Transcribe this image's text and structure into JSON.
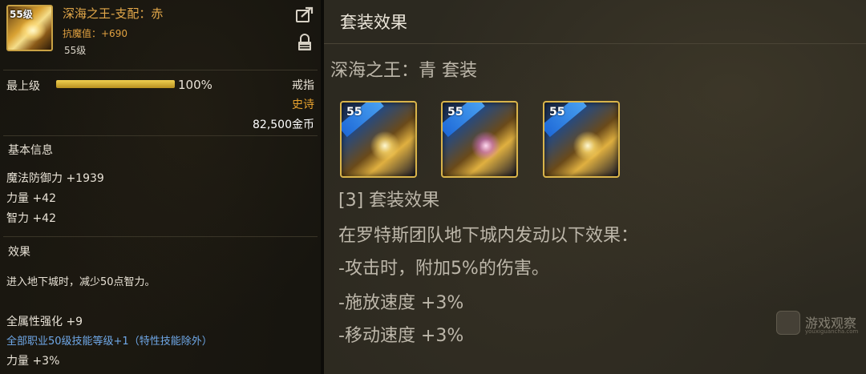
{
  "item": {
    "name": "深海之王-支配：赤",
    "icon_level": "55级",
    "resist": "抗魔值：+690",
    "level": "55级",
    "icon_name": "glowing-weapon-icon"
  },
  "grade": {
    "label": "最上级",
    "percent": 100,
    "percent_text": "100%",
    "slot": "戒指",
    "rarity": "史诗",
    "price": "82,500金币"
  },
  "basic_info": {
    "title": "基本信息",
    "stats": [
      "魔法防御力 +1939",
      "力量 +42",
      "智力 +42"
    ]
  },
  "effects": {
    "title": "效果",
    "lines": [
      "进入地下城时，减少50点智力。"
    ],
    "stats": [
      "全属性强化 +9",
      "全部职业50级技能等级+1（特性技能除外）",
      "力量 +3%"
    ]
  },
  "set_panel": {
    "title": "套装效果",
    "set_name": "深海之王：青  套装",
    "icons": [
      {
        "level": "55",
        "icon_name": "set-weapon-icon"
      },
      {
        "level": "55",
        "icon_name": "set-ring-icon"
      },
      {
        "level": "55",
        "icon_name": "set-bracelet-icon"
      }
    ],
    "effect_lines": [
      "[3] 套装效果",
      "在罗特斯团队地下城内发动以下效果：",
      "-攻击时，附加5%的伤害。",
      "-施放速度 +3%",
      "-移动速度 +3%"
    ]
  },
  "watermark": {
    "text": "游戏观察",
    "sub": "youxiguancha.com"
  },
  "colors": {
    "item_name": "#e3a84a",
    "rarity": "#e6a12e",
    "skill_line": "#6fa8e8",
    "frame_gold": "#d9b44a"
  }
}
